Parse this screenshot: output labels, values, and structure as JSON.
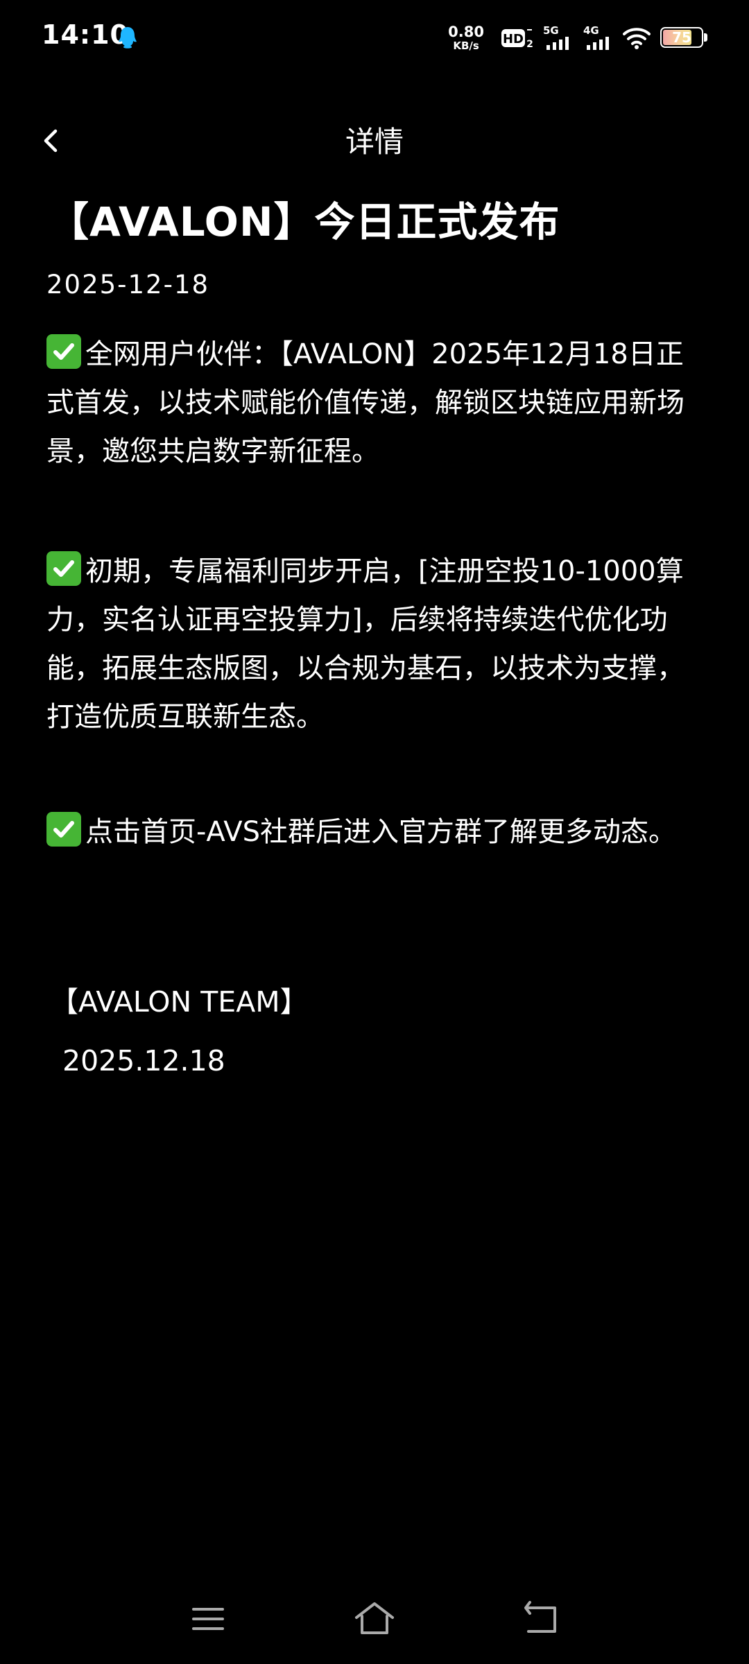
{
  "status_bar": {
    "time": "14:10",
    "net_speed_value": "0.80",
    "net_speed_unit": "KB/s",
    "hd_label": "HD",
    "hd_sub": "2",
    "sim1_label": "5G",
    "sim2_label": "4G",
    "battery_level": "75",
    "battery_fraction": 0.75
  },
  "header": {
    "title": "详情"
  },
  "article": {
    "title": "【AVALON】今日正式发布",
    "date": "2025-12-18",
    "paragraphs": [
      "全网用户伙伴：【AVALON】2025年12月18日正式首发，以技术赋能价值传递，解锁区块链应用新场景，邀您共启数字新征程。",
      "初期，专属福利同步开启，[注册空投10-1000算力，实名认证再空投算力]，后续将持续迭代优化功能，拓展生态版图，以合规为基石，以技术为支撑，打造优质互联新生态。",
      "点击首页-AVS社群后进入官方群了解更多动态。"
    ],
    "signature_team": "【AVALON TEAM】",
    "signature_date": "2025.12.18"
  },
  "icons": {
    "back": "chevron-left-icon",
    "check": "check-mark-button-icon",
    "menu": "menu-icon",
    "home": "home-icon",
    "return": "return-icon"
  },
  "colors": {
    "background": "#000000",
    "text": "#ffffff",
    "check_green": "#46b535",
    "qq_blue": "#1fb6ff"
  }
}
